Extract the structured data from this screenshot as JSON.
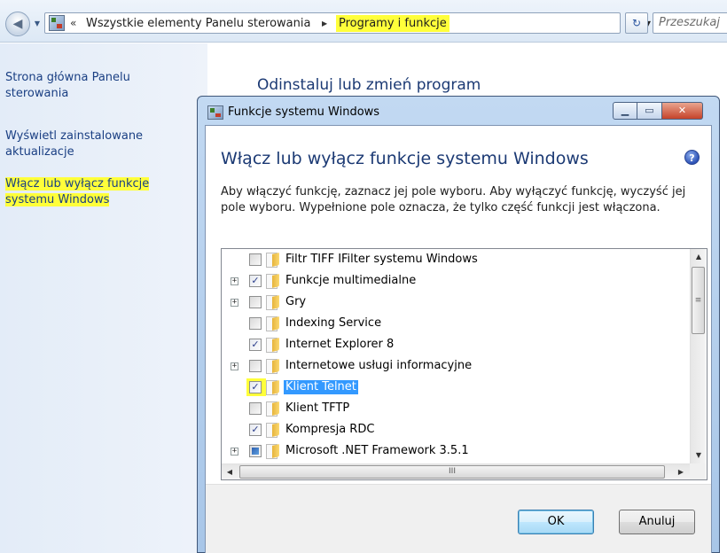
{
  "explorer": {
    "address": {
      "overflow_chevron": "«",
      "separator": "▶",
      "crumbs": [
        "Wszystkie elementy Panelu sterowania",
        "Programy i funkcje"
      ]
    },
    "search_placeholder": "Przeszukaj",
    "refresh_glyph": "↻"
  },
  "left_pane": {
    "links": [
      "Strona główna Panelu sterowania",
      "Wyświetl zainstalowane aktualizacje",
      "Włącz lub wyłącz funkcje systemu Windows"
    ]
  },
  "content": {
    "title": "Odinstaluj lub zmień program"
  },
  "dialog": {
    "title": "Funkcje systemu Windows",
    "heading": "Włącz lub wyłącz funkcje systemu Windows",
    "description": "Aby włączyć funkcję, zaznacz jej pole wyboru. Aby wyłączyć funkcję, wyczyść jej pole wyboru. Wypełnione pole oznacza, że tylko część funkcji jest włączona.",
    "help_glyph": "?",
    "features": [
      {
        "label": "Filtr TIFF IFilter systemu Windows",
        "state": "unchecked",
        "expandable": false
      },
      {
        "label": "Funkcje multimedialne",
        "state": "checked",
        "expandable": true
      },
      {
        "label": "Gry",
        "state": "unchecked",
        "expandable": true
      },
      {
        "label": "Indexing Service",
        "state": "unchecked",
        "expandable": false
      },
      {
        "label": "Internet Explorer 8",
        "state": "checked",
        "expandable": false
      },
      {
        "label": "Internetowe usługi informacyjne",
        "state": "unchecked",
        "expandable": true
      },
      {
        "label": "Klient Telnet",
        "state": "checked",
        "expandable": false,
        "selected": true
      },
      {
        "label": "Klient TFTP",
        "state": "unchecked",
        "expandable": false
      },
      {
        "label": "Kompresja RDC",
        "state": "checked",
        "expandable": false
      },
      {
        "label": "Microsoft .NET Framework 3.5.1",
        "state": "partial",
        "expandable": true
      }
    ],
    "ok_label": "OK",
    "cancel_label": "Anuluj",
    "accent_colors": {
      "highlight_marker": "#ffff3a",
      "selection": "#3399ff",
      "close_button": "#c5432a"
    }
  }
}
